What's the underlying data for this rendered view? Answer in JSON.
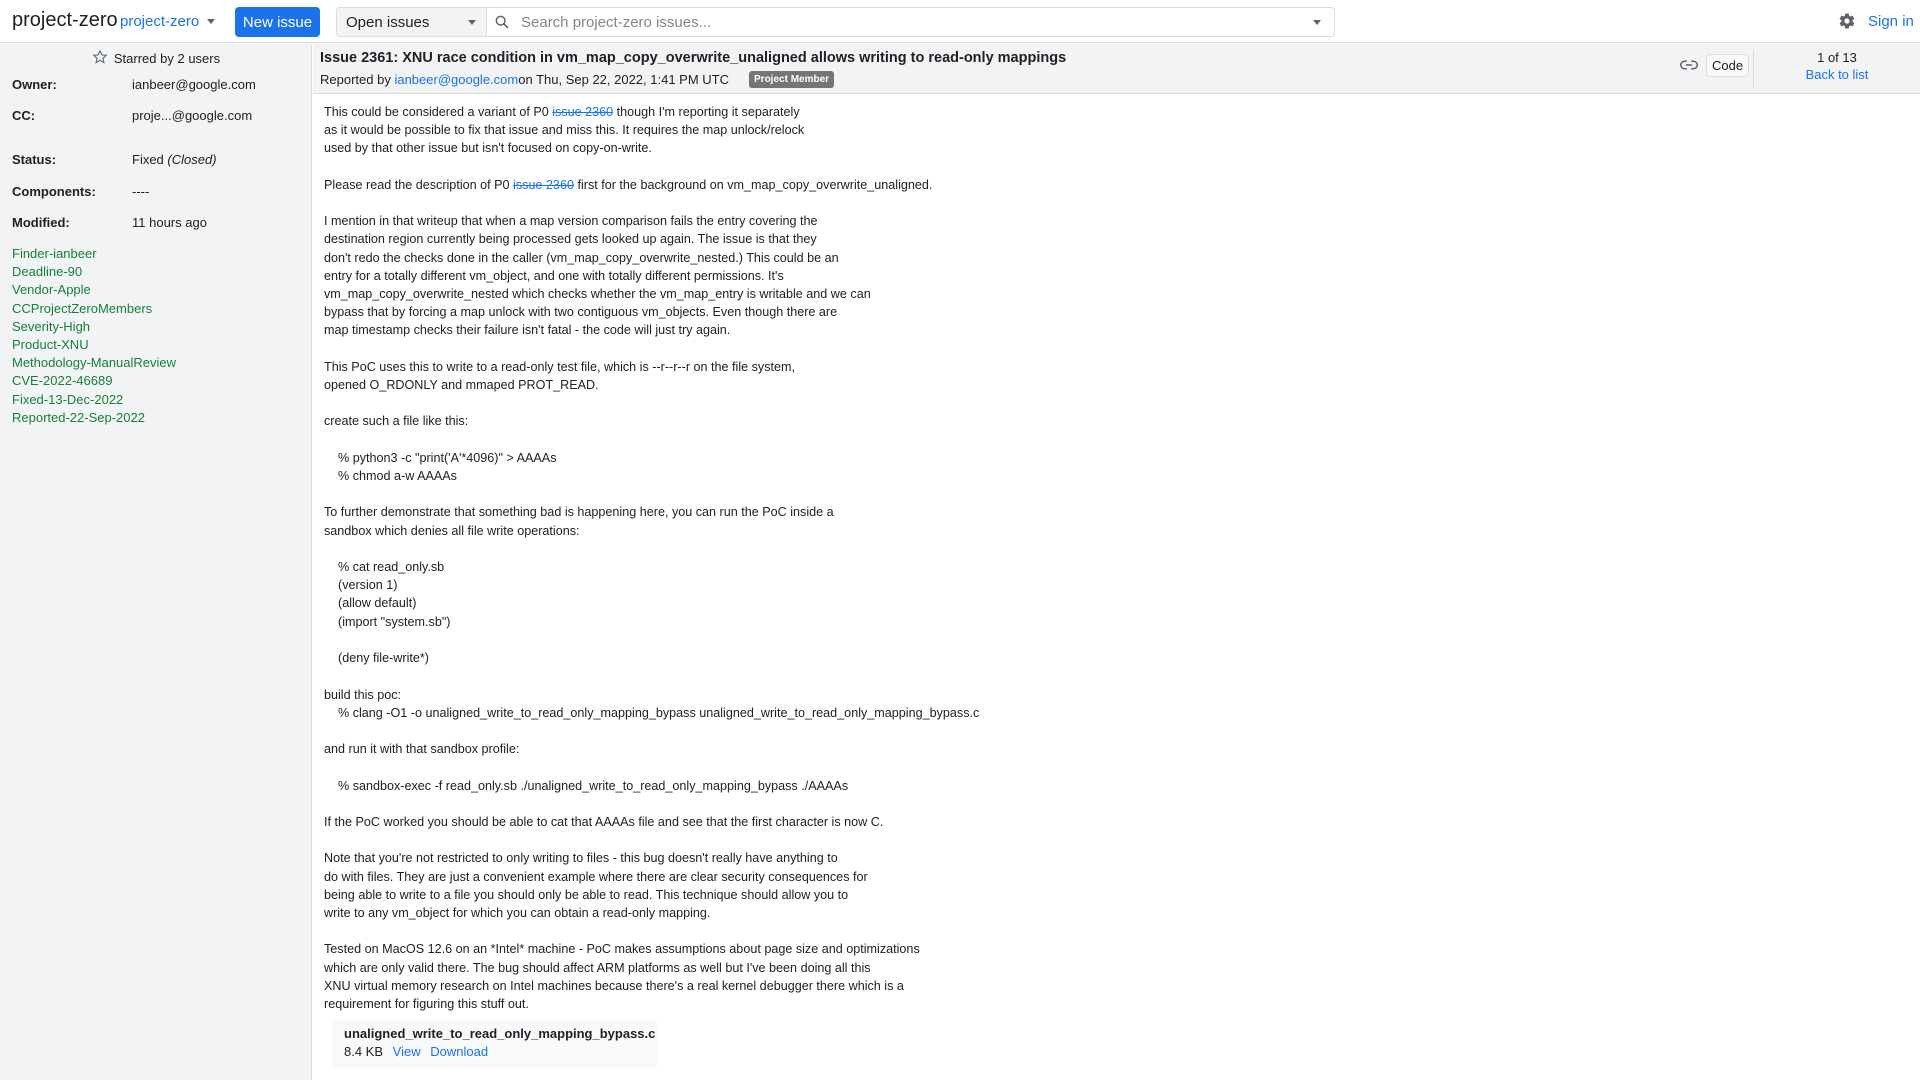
{
  "header": {
    "project_title": "project-zero",
    "project_switcher": "project-zero",
    "new_issue_label": "New issue",
    "scope_selected": "Open issues",
    "search_placeholder": "Search project-zero issues...",
    "search_value": "",
    "sign_in_label": "Sign in",
    "icons": {
      "search": "search-icon",
      "settings": "gear-icon",
      "dropdown": "chevron-down-icon"
    }
  },
  "sidebar": {
    "starred_text": "Starred by 2 users",
    "owner_label": "Owner:",
    "owner_value": "ianbeer@google.com",
    "cc_label": "CC:",
    "cc_value": "proje...@google.com",
    "status_label": "Status:",
    "status_value": "Fixed",
    "status_state": "(Closed)",
    "components_label": "Components:",
    "components_value": "----",
    "modified_label": "Modified:",
    "modified_value": "11 hours ago",
    "labels": [
      "Finder-ianbeer",
      "Deadline-90",
      "Vendor-Apple",
      "CCProjectZeroMembers",
      "Severity-High",
      "Product-XNU",
      "Methodology-ManualReview",
      "CVE-2022-46689",
      "Fixed-13-Dec-2022",
      "Reported-22-Sep-2022"
    ],
    "label_color": "#188038"
  },
  "issue": {
    "title": "Issue 2361: XNU race condition in vm_map_copy_overwrite_unaligned allows writing to read-only mappings",
    "reported_prefix": "Reported by ",
    "reporter": "ianbeer@google.com",
    "reported_on": " on Thu, Sep 22, 2022, 1:41 PM UTC",
    "badge": "Project Member",
    "code_label": "Code",
    "pager_count": "1 of 13",
    "back_to_list": "Back to list"
  },
  "description": {
    "p1_a": "This could be considered a variant of P0 ",
    "p1_link": "issue 2360",
    "p1_b": " though I'm reporting it separately\nas it would be possible to fix that issue and miss this. It requires the map unlock/relock\nused by that other issue but isn't focused on copy-on-write.\n\nPlease read the description of P0 ",
    "p2_link": "issue 2360",
    "p2_b": " first for the background on vm_map_copy_overwrite_unaligned.\n\nI mention in that writeup that when a map version comparison fails the entry covering the\ndestination region currently being processed gets looked up again. The issue is that they\ndon't redo the checks done in the caller (vm_map_copy_overwrite_nested.) This could be an\nentry for a totally different vm_object, and one with totally different permissions. It's\nvm_map_copy_overwrite_nested which checks whether the vm_map_entry is writable and we can\nbypass that by forcing a map unlock with two contiguous vm_objects. Even though there are\nmap timestamp checks their failure isn't fatal - the code will just try again.\n\nThis PoC uses this to write to a read-only test file, which is --r--r--r on the file system,\nopened O_RDONLY and mmaped PROT_READ.\n\ncreate such a file like this:\n\n    % python3 -c \"print('A'*4096)\" > AAAAs\n    % chmod a-w AAAAs\n\nTo further demonstrate that something bad is happening here, you can run the PoC inside a\nsandbox which denies all file write operations:\n\n    % cat read_only.sb\n    (version 1)\n    (allow default)\n    (import \"system.sb\")\n\n    (deny file-write*)\n\nbuild this poc:\n    % clang -O1 -o unaligned_write_to_read_only_mapping_bypass unaligned_write_to_read_only_mapping_bypass.c\n\nand run it with that sandbox profile:\n\n    % sandbox-exec -f read_only.sb ./unaligned_write_to_read_only_mapping_bypass ./AAAAs\n\nIf the PoC worked you should be able to cat that AAAAs file and see that the first character is now C.\n\nNote that you're not restricted to only writing to files - this bug doesn't really have anything to\ndo with files. They are just a convenient example where there are clear security consequences for\nbeing able to write to a file you should only be able to read. This technique should allow you to\nwrite to any vm_object for which you can obtain a read-only mapping.\n\nTested on MacOS 12.6 on an *Intel* machine - PoC makes assumptions about page size and optimizations\nwhich are only valid there. The bug should affect ARM platforms as well but I've been doing all this\nXNU virtual memory research on Intel machines because there's a real kernel debugger there which is a\nrequirement for figuring this stuff out."
  },
  "attachment": {
    "name": "unaligned_write_to_read_only_mapping_bypass.c",
    "size": "8.4 KB",
    "view_label": "View",
    "download_label": "Download"
  },
  "colors": {
    "accent": "#1a73e8",
    "sidebar_bg": "#f1f3f4",
    "badge_bg": "#757575"
  }
}
